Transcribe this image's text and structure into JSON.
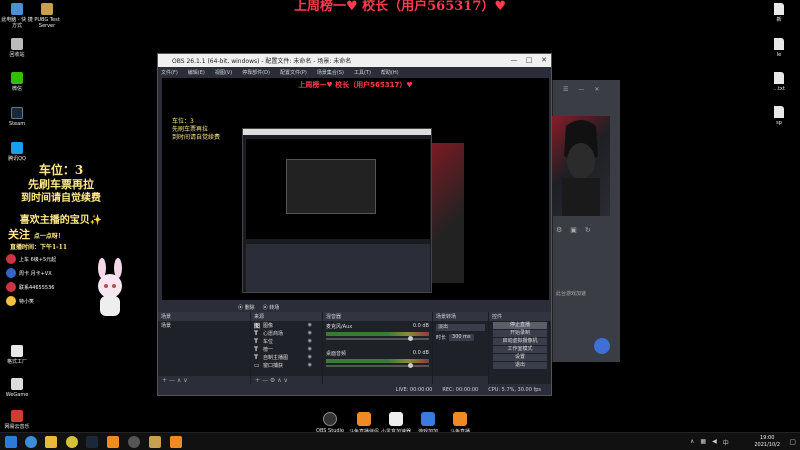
{
  "banner": {
    "text": "上周榜一♥ 校长（用户565317）♥"
  },
  "desktop_left": [
    {
      "label": "此电脑 - 快\n捷方式"
    },
    {
      "label": "PUBG Test\nServer"
    },
    {
      "label": "回收站"
    },
    {
      "label": "微信"
    },
    {
      "label": "Steam"
    },
    {
      "label": "腾讯QQ"
    }
  ],
  "desktop_left_lower": [
    {
      "label": "格式工厂"
    },
    {
      "label": "WeGame"
    },
    {
      "label": "网易云音乐"
    }
  ],
  "desktop_right": [
    {
      "label": "新"
    },
    {
      "label": "le"
    },
    {
      "label": "...txt"
    },
    {
      "label": "sp"
    }
  ],
  "overlay": {
    "line1": "车位：3",
    "line2": "先刷车票再拉",
    "line3": "到时间请自觉续费",
    "line4": "喜欢主播的宝贝✨",
    "line5": "关注",
    "line5b": "点一点呀！",
    "line6": "直播时间：下午1-11"
  },
  "tray_rows": [
    {
      "text": "上车 6级+5元起",
      "color": "#cc3344"
    },
    {
      "text": "周卡 月卡+VX",
      "color": "#3366cc"
    },
    {
      "text": "联系44655536",
      "color": "#cc3344"
    },
    {
      "text": "特小笑",
      "color": "#f0c040"
    }
  ],
  "obs": {
    "title": "OBS 26.1.1 (64-bit, windows) - 配置文件: 未命名 - 场景: 未命名",
    "menu": [
      "文件(F)",
      "编辑(E)",
      "视图(V)",
      "停靠部件(D)",
      "配置文件(P)",
      "场景集合(S)",
      "工具(T)",
      "帮助(H)"
    ],
    "banner": "上周榜一♥ 校长（用户565317）♥",
    "tabs": [
      "删除",
      "转场"
    ],
    "docks": {
      "scenes": {
        "header": "场景",
        "items": [
          "场景"
        ]
      },
      "sources": {
        "header": "来源",
        "items": [
          {
            "type": "图",
            "label": "图像"
          },
          {
            "type": "T",
            "label": "心愿商场"
          },
          {
            "type": "T",
            "label": "车位"
          },
          {
            "type": "T",
            "label": "榜一"
          },
          {
            "type": "T",
            "label": "自制主播图"
          },
          {
            "type": "▭",
            "label": "窗口捕获"
          }
        ]
      },
      "mixer": {
        "header": "混音器",
        "channels": [
          {
            "name": "麦克风/Aux",
            "db": "0.0 dB"
          },
          {
            "name": "桌面音频",
            "db": "0.0 dB"
          }
        ]
      },
      "transitions": {
        "header": "场景转场",
        "mode": "淡出",
        "duration_label": "时长",
        "duration": "300 ms"
      },
      "controls": {
        "header": "控件",
        "buttons": [
          "停止直播",
          "开始录制",
          "启动虚拟摄像机",
          "工作室模式",
          "设置",
          "退出"
        ]
      }
    },
    "status": {
      "live": "LIVE: 00:00:00",
      "rec": "REC: 00:00:00",
      "cpu": "CPU: 5.7%, 30.00 fps"
    }
  },
  "game_sidebar": {
    "label": "此台游戏加速"
  },
  "bottom_apps": [
    {
      "label": "OBS Studio"
    },
    {
      "label": "斗鱼直播伴侣"
    },
    {
      "label": "小黑盒加速器"
    },
    {
      "label": "游戏加加"
    },
    {
      "label": "斗鱼直播"
    }
  ],
  "clock": {
    "time": "19:00",
    "date": "2021/10/2"
  }
}
